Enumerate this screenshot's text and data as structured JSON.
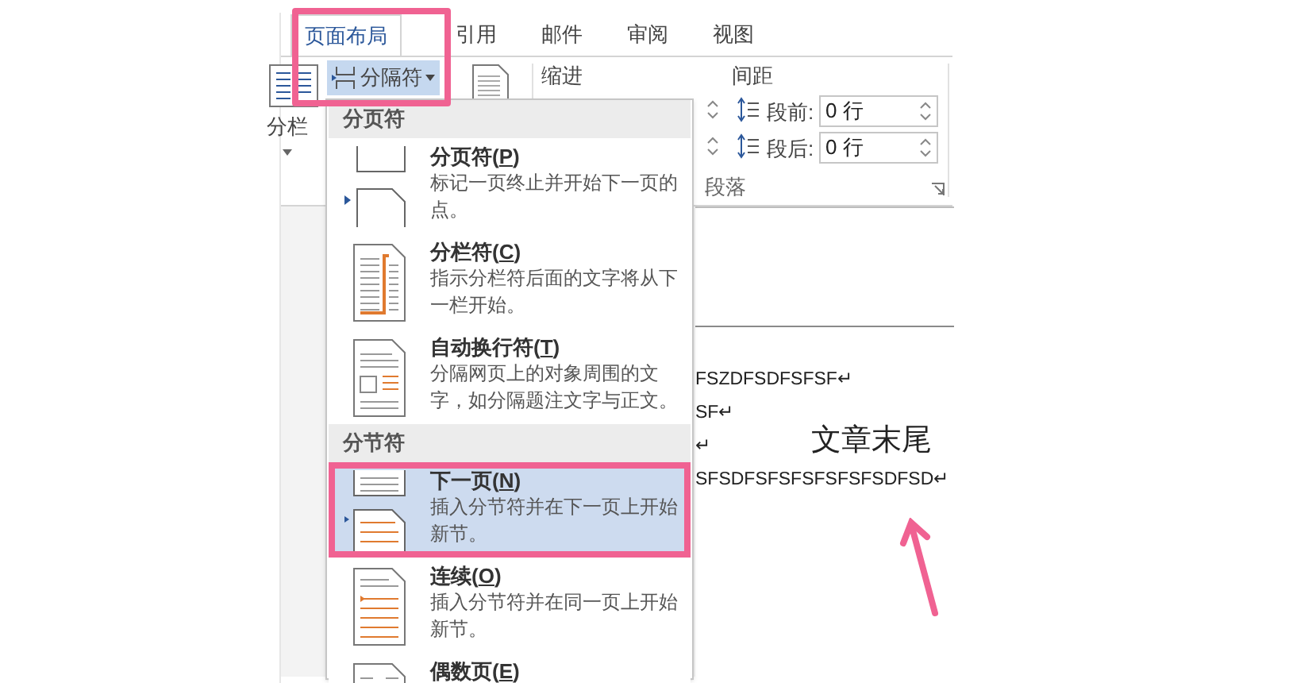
{
  "tabs": [
    {
      "label": "页面布局",
      "selected": true
    },
    {
      "label": "引用",
      "selected": false
    },
    {
      "label": "邮件",
      "selected": false
    },
    {
      "label": "审阅",
      "selected": false
    },
    {
      "label": "视图",
      "selected": false
    }
  ],
  "ribbon": {
    "columns_button": {
      "label": "分栏"
    },
    "breaks_button": {
      "label": "分隔符",
      "selected": true
    },
    "indent": {
      "label": "缩进"
    },
    "spacing": {
      "label": "间距",
      "fields": [
        {
          "kind": "before",
          "label": "段前:",
          "value": "0 行"
        },
        {
          "kind": "after",
          "label": "段后:",
          "value": "0 行"
        }
      ]
    },
    "group_label": "段落"
  },
  "breaks_menu": {
    "sections": [
      {
        "header": "分页符",
        "items": [
          {
            "kind": "page",
            "title": "分页符(P)",
            "description": "标记一页终止并开始下一页的点。",
            "selected": false
          },
          {
            "kind": "column",
            "title": "分栏符(C)",
            "description": "指示分栏符后面的文字将从下一栏开始。",
            "selected": false
          },
          {
            "kind": "wrap",
            "title": "自动换行符(T)",
            "description": "分隔网页上的对象周围的文字，如分隔题注文字与正文。",
            "selected": false
          }
        ]
      },
      {
        "header": "分节符",
        "items": [
          {
            "kind": "next",
            "title": "下一页(N)",
            "description": "插入分节符并在下一页上开始新节。",
            "selected": true
          },
          {
            "kind": "continuous",
            "title": "连续(O)",
            "description": "插入分节符并在同一页上开始新节。",
            "selected": false
          },
          {
            "kind": "even",
            "title": "偶数页(E)",
            "selected": false
          }
        ]
      }
    ]
  },
  "document": {
    "lines": [
      "FSZDFSDFSFSF↵",
      "SF↵",
      "↵",
      "SFSDFSFSFSFSFSFSDFSD↵"
    ],
    "annotation": "文章末尾"
  }
}
